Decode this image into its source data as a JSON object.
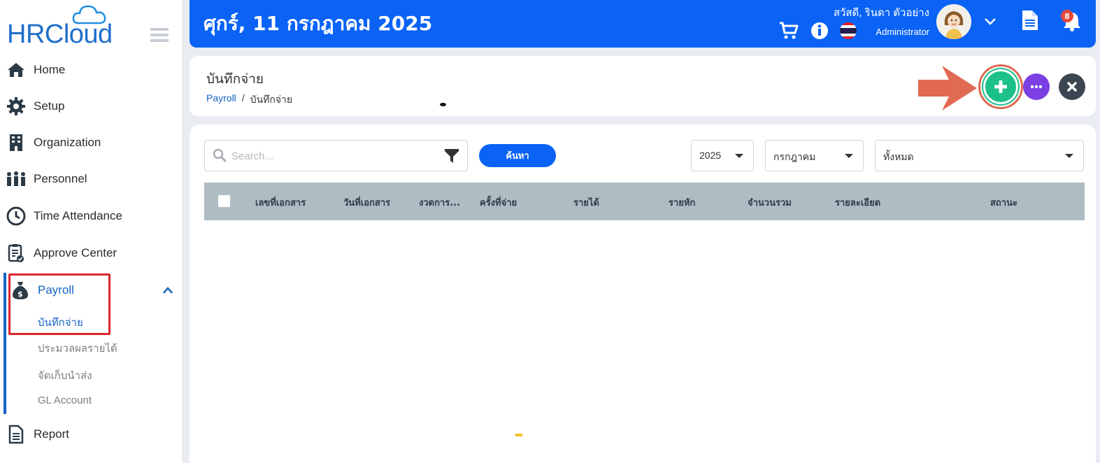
{
  "app": {
    "logo_text": "HRCloud"
  },
  "sidebar": {
    "items": [
      {
        "label": "Home",
        "icon": "home-icon"
      },
      {
        "label": "Setup",
        "icon": "gear-icon"
      },
      {
        "label": "Organization",
        "icon": "building-icon"
      },
      {
        "label": "Personnel",
        "icon": "people-icon"
      },
      {
        "label": "Time Attendance",
        "icon": "clock-icon"
      },
      {
        "label": "Approve Center",
        "icon": "clipboard-check-icon"
      },
      {
        "label": "Payroll",
        "icon": "money-bag-icon",
        "expanded": true
      },
      {
        "label": "Report",
        "icon": "report-icon"
      }
    ],
    "payroll_sub": [
      {
        "label": "บันทึกจ่าย",
        "active": true
      },
      {
        "label": "ประมวลผลรายได้",
        "active": false
      },
      {
        "label": "จัดเก็บนำส่ง",
        "active": false
      },
      {
        "label": "GL Account",
        "active": false
      }
    ]
  },
  "header": {
    "date": "ศุกร์, 11 กรกฎาคม 2025",
    "greeting": "สวัสดี, รินดา ตัวอย่าง",
    "role": "Administrator",
    "notification_count": "8"
  },
  "page": {
    "title": "บันทึกจ่าย",
    "breadcrumb": [
      {
        "label": "Payroll",
        "link": true
      },
      {
        "label": "/",
        "link": false
      },
      {
        "label": "บันทึกจ่าย",
        "link": false
      }
    ]
  },
  "filters": {
    "search_placeholder": "Search...",
    "search_value": "",
    "search_button": "ค้นหา",
    "year": "2025",
    "month": "กรกฎาคม",
    "status": "ทั้งหมด"
  },
  "table": {
    "columns": [
      "เลขที่เอกสาร",
      "วันที่เอกสาร",
      "งวดการ...",
      "ครั้งที่จ่าย",
      "รายได้",
      "รายหัก",
      "จำนวนรวม",
      "รายละเอียด",
      "สถานะ"
    ],
    "rows": []
  },
  "colors": {
    "primary": "#0a63f5",
    "add_button": "#1bc08b",
    "more_button": "#7b3fe4",
    "close_button": "#3b4652",
    "highlight": "#d9262c",
    "arrow": "#e06a52",
    "table_header": "#b0bcc4"
  }
}
